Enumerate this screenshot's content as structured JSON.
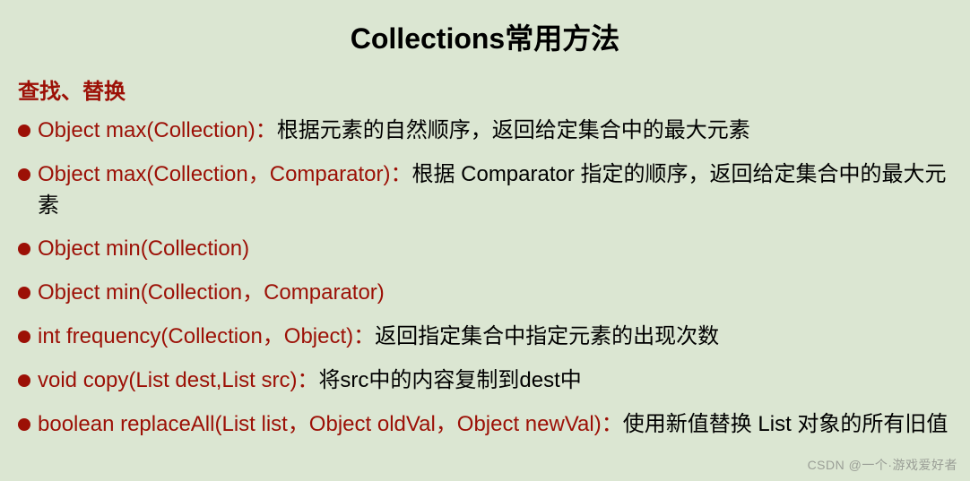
{
  "title": "Collections常用方法",
  "subtitle": "查找、替换",
  "items": [
    {
      "code": "Object max(Collection)：",
      "desc": "根据元素的自然顺序，返回给定集合中的最大元素"
    },
    {
      "code": "Object max(Collection，Comparator)：",
      "desc": "根据 Comparator 指定的顺序，返回给定集合中的最大元素"
    },
    {
      "code": "Object min(Collection)",
      "desc": ""
    },
    {
      "code": "Object min(Collection，Comparator)",
      "desc": ""
    },
    {
      "code": "int frequency(Collection，Object)：",
      "desc": "返回指定集合中指定元素的出现次数"
    },
    {
      "code": "void copy(List dest,List src)：",
      "desc": "将src中的内容复制到dest中"
    },
    {
      "code": "boolean replaceAll(List list，Object oldVal，Object newVal)：",
      "desc": "使用新值替换 List 对象的所有旧值"
    }
  ],
  "watermark": "CSDN @一个·游戏爱好者"
}
